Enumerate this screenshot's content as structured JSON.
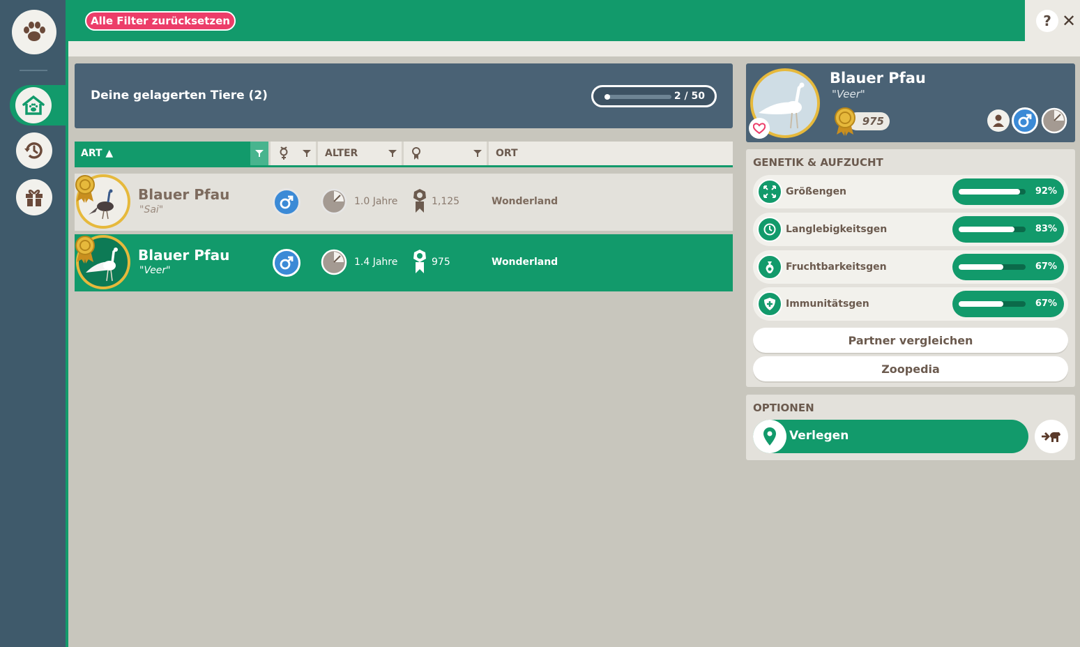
{
  "topbar": {
    "reset_filters_label": "Alle Filter zurücksetzen",
    "help_label": "?",
    "close_label": "✕"
  },
  "sidebar": {
    "items": [
      {
        "name": "paw-logo",
        "icon": "paw-icon"
      },
      {
        "name": "habitat",
        "icon": "habitat-paw-icon",
        "active": true
      },
      {
        "name": "history",
        "icon": "history-icon"
      },
      {
        "name": "gifts",
        "icon": "gift-icon"
      }
    ]
  },
  "storage": {
    "title": "Deine gelagerten Tiere (2)",
    "capacity_text": "2 / 50",
    "capacity_fraction": 0.04
  },
  "columns": {
    "art": "ART ▲",
    "alter": "ALTER",
    "ort": "ORT"
  },
  "animals": [
    {
      "name": "Blauer Pfau",
      "nick": "\"Sai\"",
      "age": "1.0 Jahre",
      "score": "1,125",
      "location": "Wonderland",
      "selected": false
    },
    {
      "name": "Blauer Pfau",
      "nick": "\"Veer\"",
      "age": "1.4 Jahre",
      "score": "975",
      "location": "Wonderland",
      "selected": true
    }
  ],
  "detail": {
    "name": "Blauer Pfau",
    "nick": "\"Veer\"",
    "score": "975",
    "genetics_title": "GENETIK & AUFZUCHT",
    "genes": [
      {
        "label": "Größengen",
        "pct": "92%",
        "value": 0.92,
        "icon": "expand-icon"
      },
      {
        "label": "Langlebigkeitsgen",
        "pct": "83%",
        "value": 0.83,
        "icon": "clock-icon"
      },
      {
        "label": "Fruchtbarkeitsgen",
        "pct": "67%",
        "value": 0.67,
        "icon": "fertility-icon"
      },
      {
        "label": "Immunitätsgen",
        "pct": "67%",
        "value": 0.67,
        "icon": "shield-plus-icon"
      }
    ],
    "compare_label": "Partner vergleichen",
    "zoopedia_label": "Zoopedia",
    "options_title": "OPTIONEN",
    "move_label": "Verlegen"
  },
  "colors": {
    "green": "#129a6b",
    "slate": "#4a6275",
    "gold": "#e6b93c",
    "pink": "#ec3d69",
    "male_blue": "#3b8ad6"
  }
}
